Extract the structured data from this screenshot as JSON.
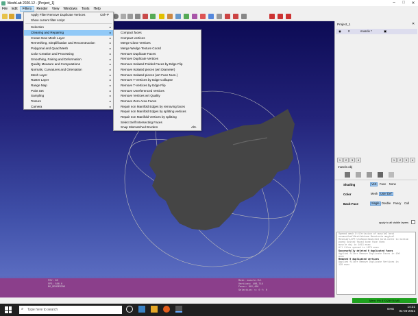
{
  "window": {
    "title": "MeshLab 2020.12 - [Project_1]"
  },
  "menubar": [
    "File",
    "Edit",
    "Filters",
    "Render",
    "View",
    "Windows",
    "Tools",
    "Help"
  ],
  "filters_menu": [
    {
      "label": "Apply Filter Remove Duplicate Vertices",
      "shortcut": "Ctrl+P"
    },
    {
      "label": "Show current filter script"
    },
    {
      "sep": true
    },
    {
      "label": "Selection",
      "submenu": true
    },
    {
      "label": "Cleaning and Repairing",
      "submenu": true,
      "highlight": true
    },
    {
      "label": "Create New Mesh Layer",
      "submenu": true
    },
    {
      "label": "Remeshing, Simplification and Reconstruction",
      "submenu": true
    },
    {
      "label": "Polygonal and Quad Mesh",
      "submenu": true
    },
    {
      "label": "Color Creation and Processing",
      "submenu": true
    },
    {
      "label": "Smoothing, Fairing and Deformation",
      "submenu": true
    },
    {
      "label": "Quality Measure and Computations",
      "submenu": true
    },
    {
      "label": "Normals, Curvatures and Orientation",
      "submenu": true
    },
    {
      "label": "Mesh Layer",
      "submenu": true
    },
    {
      "label": "Raster Layer",
      "submenu": true
    },
    {
      "label": "Range Map",
      "submenu": true
    },
    {
      "label": "Point Set",
      "submenu": true
    },
    {
      "label": "Sampling",
      "submenu": true
    },
    {
      "label": "Texture",
      "submenu": true
    },
    {
      "label": "Camera",
      "submenu": true
    }
  ],
  "cleaning_menu": [
    {
      "label": "Compact faces"
    },
    {
      "label": "Compact vertices"
    },
    {
      "label": "Merge Close Vertices"
    },
    {
      "label": "Merge Wedge Texture Coord"
    },
    {
      "label": "Remove Duplicate Faces"
    },
    {
      "label": "Remove Duplicate Vertices"
    },
    {
      "label": "Remove Isolated Folded Faces by Edge Flip"
    },
    {
      "label": "Remove Isolated pieces (wrt Diameter)"
    },
    {
      "label": "Remove Isolated pieces (wrt Face Num.)"
    },
    {
      "label": "Remove T-Vertices by Edge Collapse"
    },
    {
      "label": "Remove T-Vertices by Edge Flip"
    },
    {
      "label": "Remove Unreferenced Vertices"
    },
    {
      "label": "Remove Vertices wrt Quality"
    },
    {
      "label": "Remove Zero Area Faces"
    },
    {
      "label": "Repair non Manifold Edges by removing faces"
    },
    {
      "label": "Repair non Manifold Edges by splitting vertices"
    },
    {
      "label": "Repair non Manifold Vertices by splitting"
    },
    {
      "label": "Select Self Intersecting Faces"
    },
    {
      "label": "Snap Mismatched Borders",
      "shortcut": "Alt+"
    }
  ],
  "viewport_info_left": [
    "FOV: 60",
    "FPS:   500.0",
    "BO_RENDERING"
  ],
  "viewport_info_right": [
    "Mesh: muscle.fbl",
    "Vertices: 408,718",
    "Faces: 815,406",
    "Selection: v: 0 f: 0"
  ],
  "panel": {
    "title": "Project_1",
    "layer_index": "0",
    "layer_name": "muscle *",
    "tabs_top": [
      "1",
      "2",
      "3",
      "4"
    ],
    "tabs_top_right": [
      "1",
      "2",
      "3",
      "4"
    ],
    "mesh_file": "muscle.obj",
    "shading_label": "Shading",
    "shading_opts": [
      "Vert",
      "Face",
      "None"
    ],
    "color_label": "Color",
    "color_opts": [
      "Mesh",
      "User Def"
    ],
    "backface_label": "Back-Face",
    "backface_opts": [
      "Single",
      "Double",
      "Fancy",
      "Cull"
    ],
    "apply_all": "apply to all visible layers"
  },
  "log": {
    "lines": [
      "Opened mesh D:\\Erriscion of muscle3 best",
      "unsmoothed\\Meshlabinem Benotesia magical",
      "MeshLab\\LCPR UnsSmoothmatched bold-nothe to bottom",
      "poend Seired faced bone face them",
      "muscle obj in 1013 msec",
      "All files opened in 1074 msec"
    ],
    "b1": "Successfully deleted 0 duplicated faces",
    "l1": "Applied filter Remove Duplicate Faces in 100",
    "l1b": "msec",
    "b2": "Removed 0 duplicated vertices",
    "l2": "Applied filter Remove Duplicate Vertices in",
    "l2b": "130 msec"
  },
  "status": {
    "memory": "Mem: 9% 870/25976 MB"
  },
  "taskbar": {
    "search_placeholder": "Type here to search",
    "lang": "ENG",
    "time": "14:31",
    "date": "01-04-2021"
  },
  "colors": {
    "viewport_top": "#0d0b55",
    "viewport_bottom_band": "#8b3f8b",
    "menu_highlight": "#91c9f7",
    "mesh": "#444444"
  }
}
